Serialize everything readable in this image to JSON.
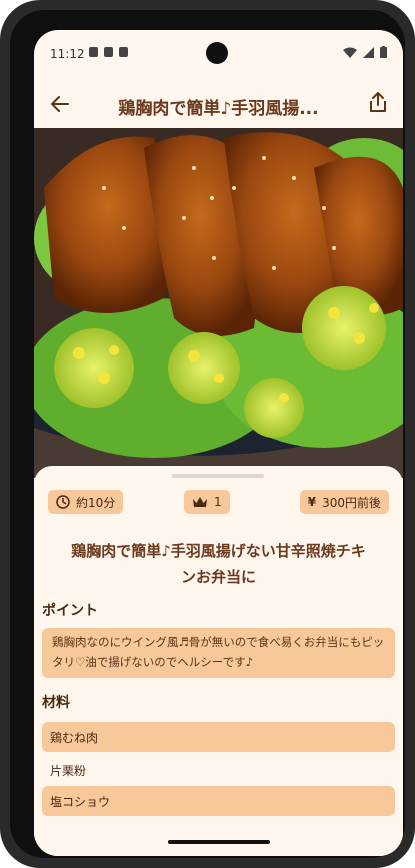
{
  "status": {
    "time": "11:12"
  },
  "appbar": {
    "title": "鶏胸肉で簡単♪手羽風揚..."
  },
  "chips": {
    "time": "約10分",
    "level": "1",
    "cost": "300円前後"
  },
  "recipe": {
    "title": "鶏胸肉で簡単♪手羽風揚げない甘辛照焼チキンお弁当に"
  },
  "point": {
    "label": "ポイント",
    "text": "鶏胸肉なのにウイング風♬骨が無いので食べ易くお弁当にもピッタリ♡油で揚げないのでヘルシーです♪"
  },
  "ingredients": {
    "label": "材料",
    "items": [
      "鶏むね肉",
      "片栗粉",
      "塩コショウ"
    ]
  },
  "colors": {
    "accent": "#f7c99a",
    "title": "#6b3a1d",
    "background": "#fff6ee"
  }
}
